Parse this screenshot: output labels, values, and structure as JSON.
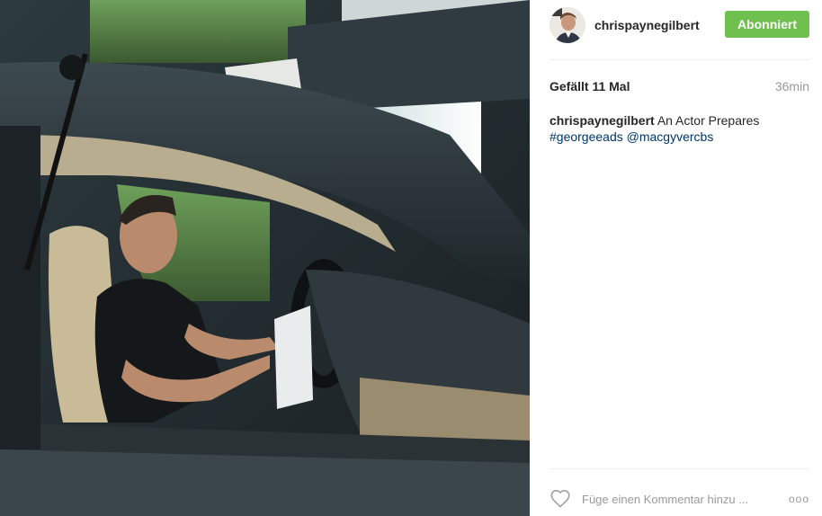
{
  "post": {
    "username": "chrispaynegilbert",
    "follow_label": "Abonniert",
    "likes": "Gefällt 11 Mal",
    "time": "36min",
    "caption_user": "chrispaynegilbert",
    "caption_text": " An Actor Prepares",
    "hashtag": "#georgeeads",
    "mention": "@macgyvercbs",
    "comment_placeholder": "Füge einen Kommentar hinzu ...",
    "more_label": "ooo"
  },
  "icons": {
    "like": "heart-outline-icon",
    "more": "more-options-icon"
  },
  "colors": {
    "follow_button": "#70c050",
    "link": "#003569",
    "muted": "#999999"
  }
}
